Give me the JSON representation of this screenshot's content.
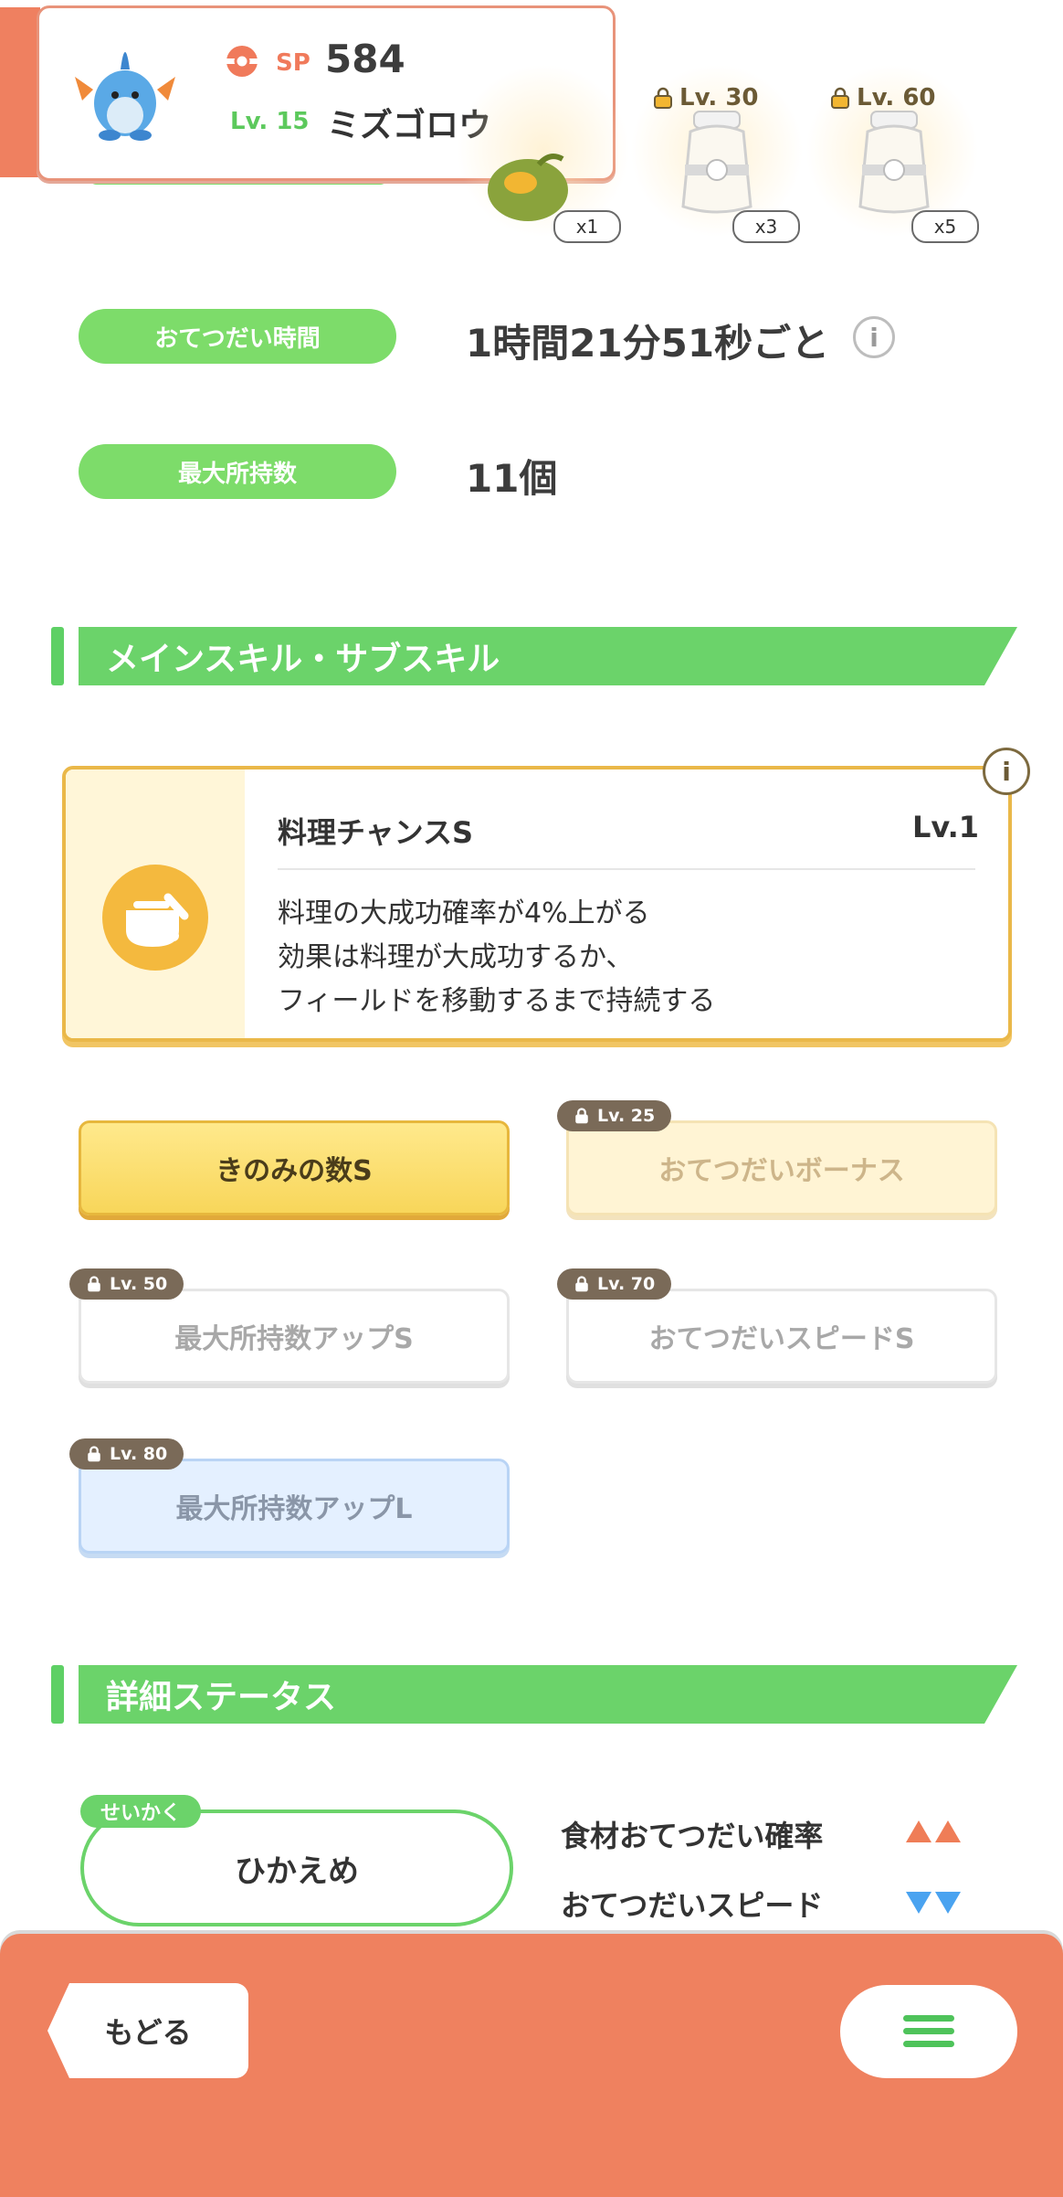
{
  "header": {
    "sp_label": "SP",
    "sp_value": "584",
    "level_label": "Lv. 15",
    "pokemon_name": "ミズゴロウ"
  },
  "rewards": [
    {
      "lock_level": "",
      "multiplier": "x1"
    },
    {
      "lock_level": "Lv. 30",
      "multiplier": "x3"
    },
    {
      "lock_level": "Lv. 60",
      "multiplier": "x5"
    }
  ],
  "info": {
    "help_time_label": "おてつだい時間",
    "help_time_value": "1時間21分51秒ごと",
    "max_carry_label": "最大所持数",
    "max_carry_value": "11個"
  },
  "skills_section": {
    "title": "メインスキル・サブスキル",
    "main_skill": {
      "name": "料理チャンスS",
      "level": "Lv.1",
      "description": [
        "料理の大成功確率が4%上がる",
        "効果は料理が大成功するか、",
        "フィールドを移動するまで持続する"
      ]
    },
    "sub_skills": [
      {
        "name": "きのみの数S",
        "lock": ""
      },
      {
        "name": "おてつだいボーナス",
        "lock": "Lv. 25"
      },
      {
        "name": "最大所持数アップS",
        "lock": "Lv. 50"
      },
      {
        "name": "おてつだいスピードS",
        "lock": "Lv. 70"
      },
      {
        "name": "最大所持数アップL",
        "lock": "Lv. 80"
      }
    ]
  },
  "status_section": {
    "title": "詳細ステータス",
    "nature_tag": "せいかく",
    "nature": "ひかえめ",
    "up_stat": "食材おてつだい確率",
    "down_stat": "おてつだいスピード"
  },
  "footer": {
    "back_label": "もどる"
  },
  "colors": {
    "accent_green": "#6bd36a",
    "header_orange": "#ef815f",
    "gold": "#eab849",
    "up_arrow": "#ef7d57",
    "down_arrow": "#4aa3f0"
  }
}
